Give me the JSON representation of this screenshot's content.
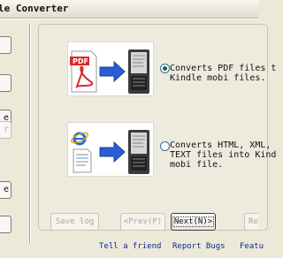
{
  "window": {
    "title": "le Converter"
  },
  "left_buttons": [
    {
      "label": ""
    },
    {
      "label": ""
    },
    {
      "label": "e"
    },
    {
      "label": "r",
      "disabled": true
    },
    {
      "label": "e"
    },
    {
      "label": ""
    }
  ],
  "options": [
    {
      "text_line1": "Converts PDF files t",
      "text_line2": "Kindle mobi files.",
      "selected": true,
      "source_icon": "pdf-file-icon",
      "target_icon": "kindle-device-icon"
    },
    {
      "text_line1": "Converts HTML, XML,",
      "text_line2": "TEXT files into Kind",
      "text_line3": "mobi file.",
      "selected": false,
      "source_icon": "internet-explorer-icon",
      "target_icon": "kindle-device-icon"
    }
  ],
  "buttons": {
    "save_log": "Save log",
    "prev": "<Prev(P)",
    "next": "Next(N)>",
    "right_partial": "Re"
  },
  "links": {
    "tell_friend": "Tell a friend",
    "report_bugs": "Report Bugs",
    "feature": "Featu"
  },
  "colors": {
    "link": "#0b2b93",
    "face": "#ece9d8",
    "arrow_blue": "#2a5cd6"
  }
}
